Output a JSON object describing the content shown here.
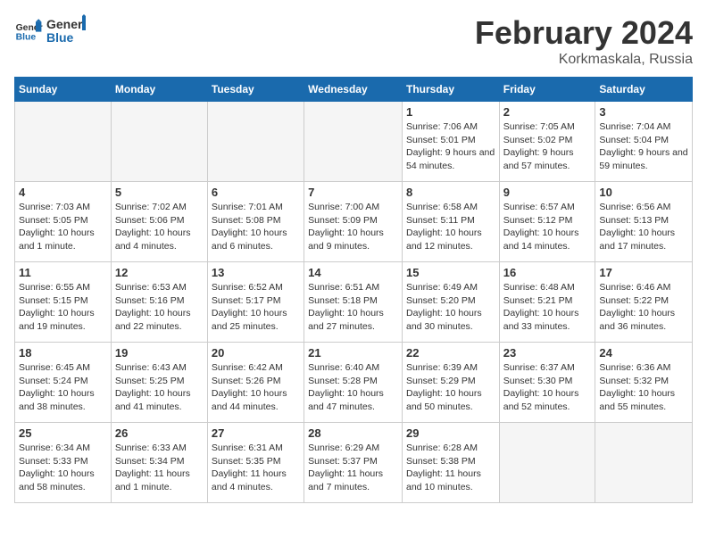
{
  "header": {
    "logo_general": "General",
    "logo_blue": "Blue",
    "month_title": "February 2024",
    "location": "Korkmaskala, Russia"
  },
  "columns": [
    "Sunday",
    "Monday",
    "Tuesday",
    "Wednesday",
    "Thursday",
    "Friday",
    "Saturday"
  ],
  "weeks": [
    [
      {
        "day": "",
        "info": ""
      },
      {
        "day": "",
        "info": ""
      },
      {
        "day": "",
        "info": ""
      },
      {
        "day": "",
        "info": ""
      },
      {
        "day": "1",
        "info": "Sunrise: 7:06 AM\nSunset: 5:01 PM\nDaylight: 9 hours and 54 minutes."
      },
      {
        "day": "2",
        "info": "Sunrise: 7:05 AM\nSunset: 5:02 PM\nDaylight: 9 hours and 57 minutes."
      },
      {
        "day": "3",
        "info": "Sunrise: 7:04 AM\nSunset: 5:04 PM\nDaylight: 9 hours and 59 minutes."
      }
    ],
    [
      {
        "day": "4",
        "info": "Sunrise: 7:03 AM\nSunset: 5:05 PM\nDaylight: 10 hours and 1 minute."
      },
      {
        "day": "5",
        "info": "Sunrise: 7:02 AM\nSunset: 5:06 PM\nDaylight: 10 hours and 4 minutes."
      },
      {
        "day": "6",
        "info": "Sunrise: 7:01 AM\nSunset: 5:08 PM\nDaylight: 10 hours and 6 minutes."
      },
      {
        "day": "7",
        "info": "Sunrise: 7:00 AM\nSunset: 5:09 PM\nDaylight: 10 hours and 9 minutes."
      },
      {
        "day": "8",
        "info": "Sunrise: 6:58 AM\nSunset: 5:11 PM\nDaylight: 10 hours and 12 minutes."
      },
      {
        "day": "9",
        "info": "Sunrise: 6:57 AM\nSunset: 5:12 PM\nDaylight: 10 hours and 14 minutes."
      },
      {
        "day": "10",
        "info": "Sunrise: 6:56 AM\nSunset: 5:13 PM\nDaylight: 10 hours and 17 minutes."
      }
    ],
    [
      {
        "day": "11",
        "info": "Sunrise: 6:55 AM\nSunset: 5:15 PM\nDaylight: 10 hours and 19 minutes."
      },
      {
        "day": "12",
        "info": "Sunrise: 6:53 AM\nSunset: 5:16 PM\nDaylight: 10 hours and 22 minutes."
      },
      {
        "day": "13",
        "info": "Sunrise: 6:52 AM\nSunset: 5:17 PM\nDaylight: 10 hours and 25 minutes."
      },
      {
        "day": "14",
        "info": "Sunrise: 6:51 AM\nSunset: 5:18 PM\nDaylight: 10 hours and 27 minutes."
      },
      {
        "day": "15",
        "info": "Sunrise: 6:49 AM\nSunset: 5:20 PM\nDaylight: 10 hours and 30 minutes."
      },
      {
        "day": "16",
        "info": "Sunrise: 6:48 AM\nSunset: 5:21 PM\nDaylight: 10 hours and 33 minutes."
      },
      {
        "day": "17",
        "info": "Sunrise: 6:46 AM\nSunset: 5:22 PM\nDaylight: 10 hours and 36 minutes."
      }
    ],
    [
      {
        "day": "18",
        "info": "Sunrise: 6:45 AM\nSunset: 5:24 PM\nDaylight: 10 hours and 38 minutes."
      },
      {
        "day": "19",
        "info": "Sunrise: 6:43 AM\nSunset: 5:25 PM\nDaylight: 10 hours and 41 minutes."
      },
      {
        "day": "20",
        "info": "Sunrise: 6:42 AM\nSunset: 5:26 PM\nDaylight: 10 hours and 44 minutes."
      },
      {
        "day": "21",
        "info": "Sunrise: 6:40 AM\nSunset: 5:28 PM\nDaylight: 10 hours and 47 minutes."
      },
      {
        "day": "22",
        "info": "Sunrise: 6:39 AM\nSunset: 5:29 PM\nDaylight: 10 hours and 50 minutes."
      },
      {
        "day": "23",
        "info": "Sunrise: 6:37 AM\nSunset: 5:30 PM\nDaylight: 10 hours and 52 minutes."
      },
      {
        "day": "24",
        "info": "Sunrise: 6:36 AM\nSunset: 5:32 PM\nDaylight: 10 hours and 55 minutes."
      }
    ],
    [
      {
        "day": "25",
        "info": "Sunrise: 6:34 AM\nSunset: 5:33 PM\nDaylight: 10 hours and 58 minutes."
      },
      {
        "day": "26",
        "info": "Sunrise: 6:33 AM\nSunset: 5:34 PM\nDaylight: 11 hours and 1 minute."
      },
      {
        "day": "27",
        "info": "Sunrise: 6:31 AM\nSunset: 5:35 PM\nDaylight: 11 hours and 4 minutes."
      },
      {
        "day": "28",
        "info": "Sunrise: 6:29 AM\nSunset: 5:37 PM\nDaylight: 11 hours and 7 minutes."
      },
      {
        "day": "29",
        "info": "Sunrise: 6:28 AM\nSunset: 5:38 PM\nDaylight: 11 hours and 10 minutes."
      },
      {
        "day": "",
        "info": ""
      },
      {
        "day": "",
        "info": ""
      }
    ]
  ]
}
